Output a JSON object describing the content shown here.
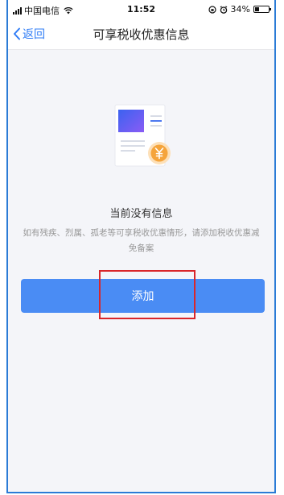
{
  "status_bar": {
    "carrier": "中国电信",
    "time": "11:52",
    "battery_percent": "34%",
    "battery_level": 0.34,
    "icons": [
      "signal-icon",
      "wifi-icon",
      "rotation-lock-icon",
      "alarm-icon",
      "battery-icon"
    ]
  },
  "nav": {
    "back_label": "返回",
    "title": "可享税收优惠信息"
  },
  "empty_state": {
    "icon": "document-with-yuan-icon",
    "title": "当前没有信息",
    "description": "如有残疾、烈属、孤老等可享税收优惠情形，请添加税收优惠减免备案"
  },
  "actions": {
    "add_label": "添加"
  },
  "colors": {
    "accent": "#2f7cf6",
    "button": "#4a8cf4",
    "background": "#f4f5f9",
    "highlight": "#d9262a",
    "coin": "#f5a43b"
  }
}
